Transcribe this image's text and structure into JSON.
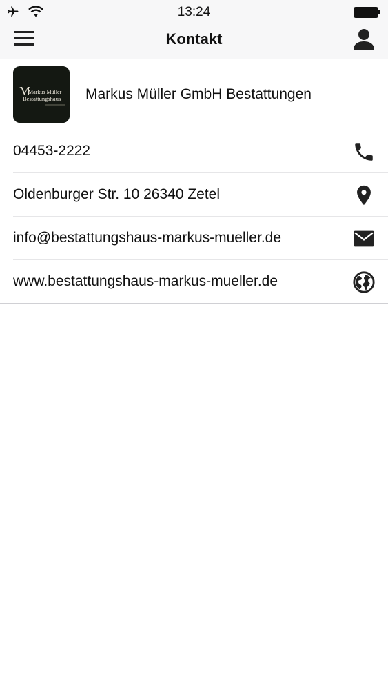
{
  "status_bar": {
    "time": "13:24",
    "icons": [
      "airplane-icon",
      "wifi-icon",
      "battery-icon"
    ]
  },
  "nav": {
    "title": "Kontakt",
    "left_icon": "hamburger-menu-icon",
    "right_icon": "person-icon"
  },
  "company": {
    "name": "Markus Müller GmbH Bestattungen",
    "logo_line1": "Markus Müller",
    "logo_line2": "Bestattungshaus"
  },
  "contact_items": [
    {
      "text": "04453-2222",
      "icon": "phone-icon"
    },
    {
      "text": "Oldenburger Str. 10 26340 Zetel",
      "icon": "location-pin-icon"
    },
    {
      "text": "info@bestattungshaus-markus-mueller.de",
      "icon": "mail-icon"
    },
    {
      "text": "www.bestattungshaus-markus-mueller.de",
      "icon": "globe-icon"
    }
  ],
  "colors": {
    "bar_background": "#f7f7f8",
    "icon_color": "#222222",
    "logo_background": "#141812"
  }
}
